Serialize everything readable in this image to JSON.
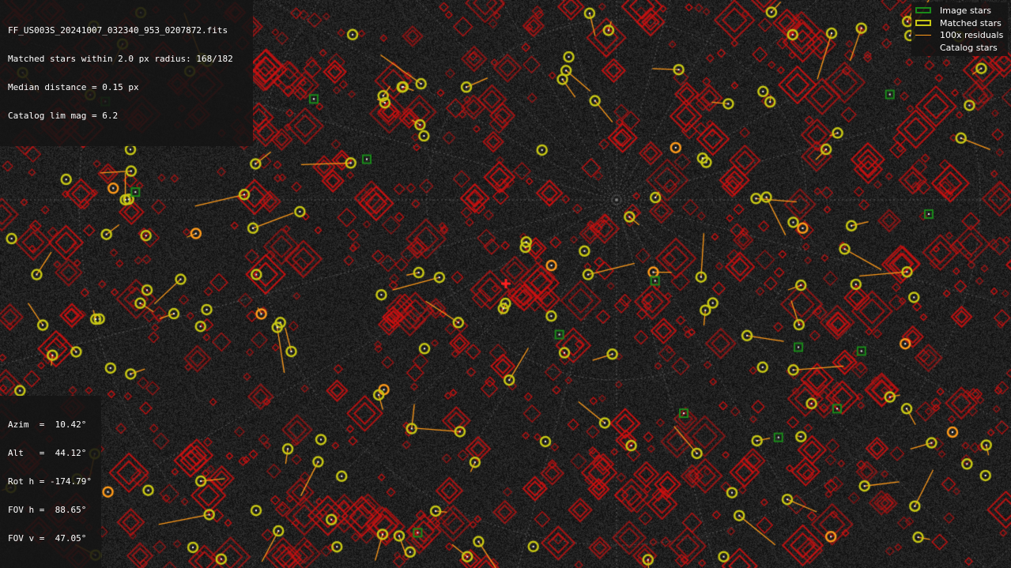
{
  "info": {
    "filename": "FF_US003S_20241007_032340_953_0207872.fits",
    "matched_stars": "Matched stars within 2.0 px radius: 168/182",
    "median_distance": "Median distance = 0.15 px",
    "catalog_lim_mag": "Catalog lim mag = 6.2"
  },
  "pointing": {
    "azim": "Azim  =  10.42°",
    "alt": "Alt   =  44.12°",
    "rot_h": "Rot h = -174.79°",
    "fov_h": "FOV h =  88.65°",
    "fov_v": "FOV v =  47.05°"
  },
  "legend": {
    "image_stars": "Image stars",
    "matched_stars": "Matched stars",
    "residuals": "100x residuals",
    "catalog_stars": "Catalog stars"
  },
  "colors": {
    "image_star": "#1a8a1a",
    "matched_star": "#c8c814",
    "residual": "#ff9a1a",
    "catalog_star": "#d01010",
    "grid": "#8a8a8a",
    "center_marker": "#ff2020",
    "background": "#050505"
  }
}
